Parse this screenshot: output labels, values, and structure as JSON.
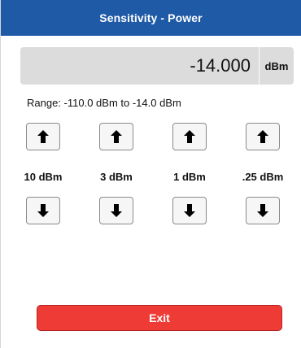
{
  "header": {
    "title": "Sensitivity - Power"
  },
  "display": {
    "value": "-14.000",
    "unit": "dBm"
  },
  "range": {
    "text": "Range: -110.0 dBm to -14.0 dBm"
  },
  "steps": [
    {
      "label": "10 dBm",
      "up_icon": "arrow-up-icon",
      "down_icon": "arrow-down-icon"
    },
    {
      "label": "3 dBm",
      "up_icon": "arrow-up-icon",
      "down_icon": "arrow-down-icon"
    },
    {
      "label": "1 dBm",
      "up_icon": "arrow-up-icon",
      "down_icon": "arrow-down-icon"
    },
    {
      "label": ".25 dBm",
      "up_icon": "arrow-up-icon",
      "down_icon": "arrow-down-icon"
    }
  ],
  "footer": {
    "exit_label": "Exit"
  },
  "colors": {
    "header": "#1f5aa7",
    "value_box": "#dcdcdc",
    "exit": "#ef3b36"
  }
}
